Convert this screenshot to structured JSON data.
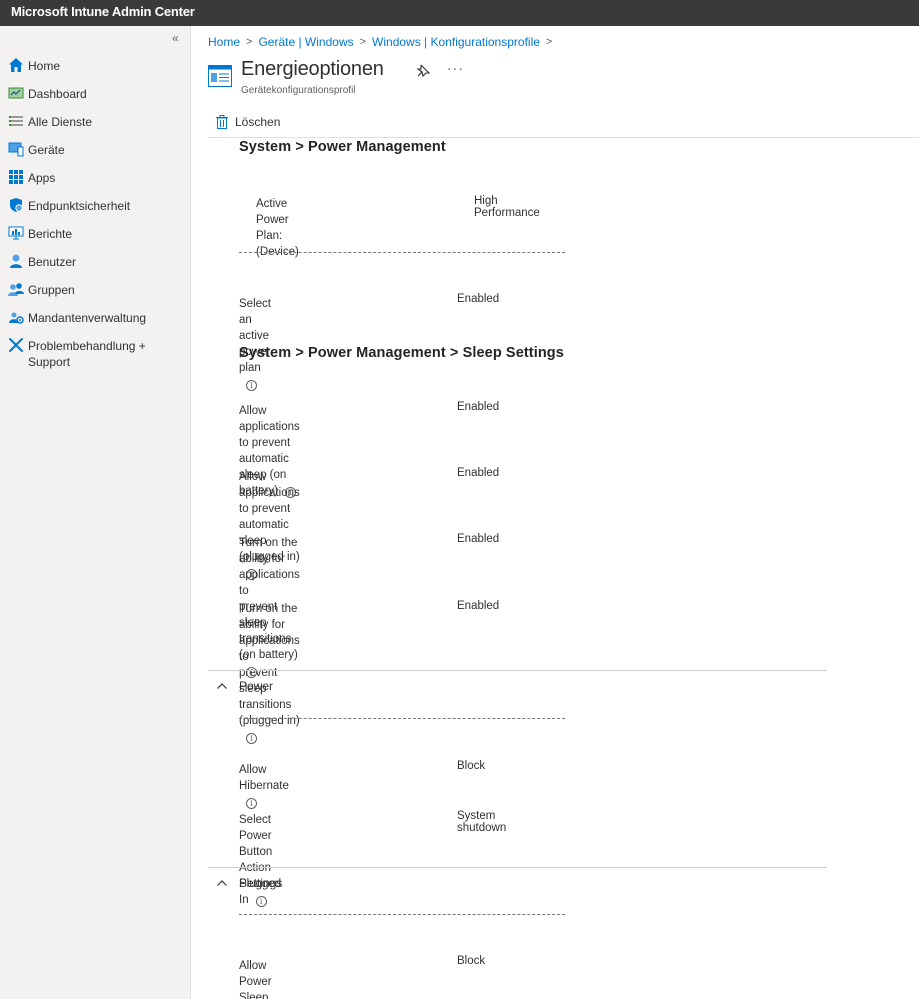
{
  "app": {
    "title": "Microsoft Intune Admin Center"
  },
  "sidebar": {
    "collapse_glyph": "«",
    "items": [
      {
        "label": "Home",
        "icon": "home-icon"
      },
      {
        "label": "Dashboard",
        "icon": "dashboard-icon"
      },
      {
        "label": "Alle Dienste",
        "icon": "list-icon"
      },
      {
        "label": "Geräte",
        "icon": "devices-icon"
      },
      {
        "label": "Apps",
        "icon": "apps-grid-icon"
      },
      {
        "label": "Endpunktsicherheit",
        "icon": "shield-icon"
      },
      {
        "label": "Berichte",
        "icon": "reports-icon"
      },
      {
        "label": "Benutzer",
        "icon": "user-icon"
      },
      {
        "label": "Gruppen",
        "icon": "groups-icon"
      },
      {
        "label": "Mandantenverwaltung",
        "icon": "tenant-gear-icon"
      },
      {
        "label": "Problembehandlung + Support",
        "icon": "wrench-icon"
      }
    ]
  },
  "breadcrumb": [
    {
      "label": "Home"
    },
    {
      "label": "Geräte | Windows"
    },
    {
      "label": "Windows | Konfigurationsprofile"
    }
  ],
  "page": {
    "title": "Energieoptionen",
    "subtitle": "Gerätekonfigurationsprofil",
    "more": "···"
  },
  "toolbar": {
    "delete_label": "Löschen"
  },
  "sections": {
    "power_mgmt": {
      "heading": "System > Power Management",
      "active_plan_label": "Active Power Plan: (Device)",
      "active_plan_value": "High Performance",
      "dashes": "-------------------------------------------------------------------------------------",
      "select_plan_label": "Select an active power plan",
      "select_plan_value": "Enabled"
    },
    "sleep": {
      "heading": "System > Power Management > Sleep Settings",
      "rows": [
        {
          "label_l1": "Allow applications to prevent automatic",
          "label_l2": "sleep (on battery)",
          "value": "Enabled"
        },
        {
          "label_l1": "Allow applications to prevent automatic",
          "label_l2": "sleep (plugged in)",
          "value": "Enabled"
        },
        {
          "label_l1": "Turn on the ability for applications to",
          "label_l2": "prevent sleep transitions (on battery)",
          "value": "Enabled"
        },
        {
          "label_l1": "Turn on the ability for applications to",
          "label_l2": "prevent sleep transitions (plugged in)",
          "value": "Enabled"
        }
      ]
    },
    "power": {
      "heading": "Power",
      "dashes": "-------------------------------------------------------------------------------------",
      "hibernate_label": "Allow Hibernate",
      "hibernate_value": "Block",
      "button_action_label": "Select Power Button Action Plugged In",
      "button_action_value": "System shutdown"
    },
    "settings": {
      "heading": "Settings",
      "dashes": "-------------------------------------------------------------------------------------",
      "power_sleep_label": "Allow Power Sleep",
      "power_sleep_value": "Block"
    }
  },
  "colors": {
    "accent": "#0078d4",
    "topbar": "#3b3a39",
    "sidebar": "#f3f2f1"
  }
}
